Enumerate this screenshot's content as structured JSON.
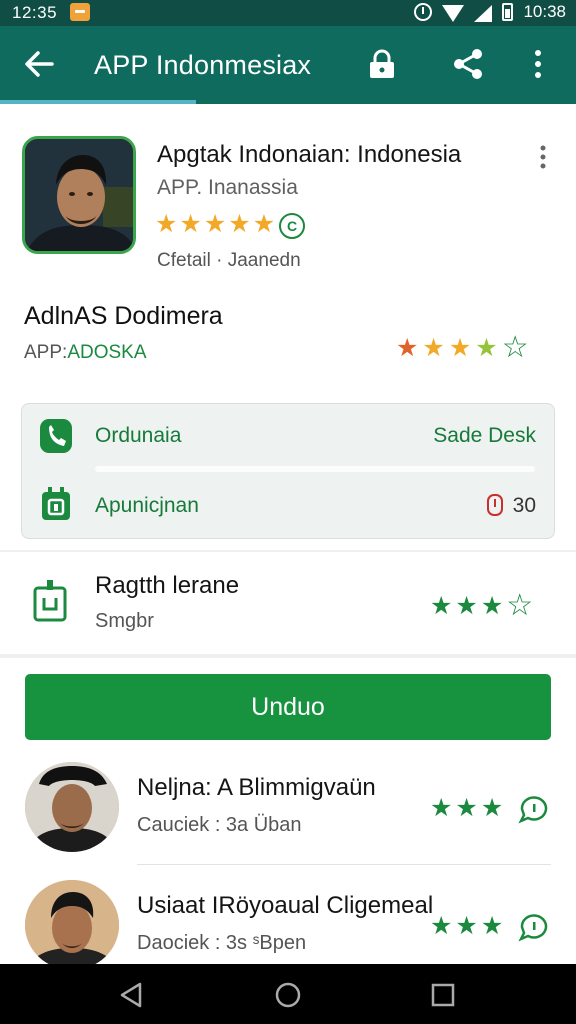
{
  "status_bar": {
    "time_left": "12:35",
    "time_right": "10:38"
  },
  "app_bar": {
    "title": "APP Indonmesiax",
    "icons": [
      "back-arrow-icon",
      "lock-icon",
      "share-icon",
      "more-vert-icon"
    ]
  },
  "app": {
    "name": "Apgtak Indonaian: Indonesia",
    "subtitle": "APP. Inanassia",
    "rating_stars": 5,
    "badge": "C",
    "meta": "Cfetail · Jaanedn"
  },
  "developer": {
    "name": "AdlnAS Dodimera",
    "sub_prefix": "APP:",
    "sub_accent": "ADOSKA",
    "rating_colors": [
      "#e0632a",
      "#f2a928",
      "#f2a928",
      "#93c43a",
      "#1b8a3f"
    ]
  },
  "info": {
    "row1_label": "Ordunaia",
    "row1_value": "Sade Desk",
    "row2_label": "Apunicjnan",
    "row2_value": "30"
  },
  "rating": {
    "title": "Ragtth lerane",
    "subtitle": "Smgbr",
    "filled": 3,
    "total": 4
  },
  "install": {
    "label": "Unduo"
  },
  "reviews": [
    {
      "name": "Neljna: A Blimmigvaün",
      "meta": "Cauciek : 3a Üban",
      "stars": 3
    },
    {
      "name": "Usiaat IRöyoaual Cligemeal",
      "meta": "Daociek : 3s ˢBpen",
      "stars": 3
    }
  ],
  "nav": {
    "icons": [
      "back-triangle-icon",
      "home-circle-icon",
      "recents-square-icon"
    ]
  },
  "colors": {
    "toolbar": "#0e6b5e",
    "status": "#0f4d45",
    "accent_green": "#17923f",
    "star_gold": "#f2a928"
  }
}
